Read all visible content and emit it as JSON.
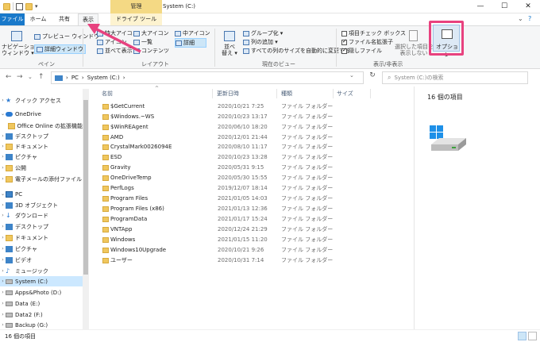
{
  "titlebar": {
    "manage_tab": "管理",
    "window_title": "System (C:)",
    "qat_dropdown": "▾",
    "minimize": "—",
    "maximize": "☐",
    "close": "✕"
  },
  "ribbon_tabs": {
    "file": "ファイル",
    "home": "ホーム",
    "share": "共有",
    "view": "表示",
    "drive_tools": "ドライブ ツール",
    "collapse": "⌄",
    "help": "?"
  },
  "ribbon": {
    "pane_group": {
      "navigation_pane": "ナビゲーション\nウィンドウ ▾",
      "preview_pane": "プレビュー ウィンドウ",
      "details_pane": "詳細ウィンドウ",
      "label": "ペイン"
    },
    "layout_group": {
      "extra_large_icons": "特大アイコン",
      "large_icons": "大アイコン",
      "medium_icons": "中アイコン",
      "small_icons": "アイコン",
      "list": "一覧",
      "details": "詳細",
      "tiles": "並べて表示",
      "content": "コンテンツ",
      "label": "レイアウト"
    },
    "current_view_group": {
      "sort": "並べ\n替え ▾",
      "group_by": "グループ化 ▾",
      "add_columns": "列の追加 ▾",
      "size_all_columns": "すべての列のサイズを自動的に変更する",
      "label": "現在のビュー"
    },
    "show_hide_group": {
      "item_checkboxes": "項目チェック ボックス",
      "file_extensions": "ファイル名拡張子",
      "hidden_items": "隠しファイル",
      "hide_selected": "選択した項目を\n表示しない",
      "label": "表示/非表示"
    },
    "options": "オプション"
  },
  "address_bar": {
    "back": "←",
    "forward": "→",
    "recent": "⌄",
    "up": "↑",
    "path": [
      "PC",
      "System (C:)"
    ],
    "separator": "›",
    "dropdown": "⌄",
    "refresh": "↻",
    "search_placeholder": "System (C:)の検索"
  },
  "nav_pane": {
    "items": [
      {
        "label": "クイック アクセス"
      },
      {
        "label": "OneDrive"
      },
      {
        "label": "Office Online の拡張機能"
      },
      {
        "label": "デスクトップ"
      },
      {
        "label": "ドキュメント"
      },
      {
        "label": "ピクチャ"
      },
      {
        "label": "公開"
      },
      {
        "label": "電子メールの添付ファイル"
      },
      {
        "label": "PC"
      },
      {
        "label": "3D オブジェクト"
      },
      {
        "label": "ダウンロード"
      },
      {
        "label": "デスクトップ"
      },
      {
        "label": "ドキュメント"
      },
      {
        "label": "ピクチャ"
      },
      {
        "label": "ビデオ"
      },
      {
        "label": "ミュージック"
      },
      {
        "label": "System (C:)"
      },
      {
        "label": "Apps&Photo (D:)"
      },
      {
        "label": "Data (E:)"
      },
      {
        "label": "Data2 (F:)"
      },
      {
        "label": "Backup (G:)"
      }
    ]
  },
  "file_list": {
    "columns": {
      "name": "名前",
      "date": "更新日時",
      "type": "種類",
      "size": "サイズ"
    },
    "sort_indicator": "^",
    "rows": [
      {
        "name": "$GetCurrent",
        "date": "2020/10/21 7:25",
        "type": "ファイル フォルダー"
      },
      {
        "name": "$Windows.~WS",
        "date": "2020/10/23 13:17",
        "type": "ファイル フォルダー"
      },
      {
        "name": "$WinREAgent",
        "date": "2020/06/10 18:20",
        "type": "ファイル フォルダー"
      },
      {
        "name": "AMD",
        "date": "2020/12/01 21:44",
        "type": "ファイル フォルダー"
      },
      {
        "name": "CrystalMark0026094E",
        "date": "2020/08/10 11:17",
        "type": "ファイル フォルダー"
      },
      {
        "name": "ESD",
        "date": "2020/10/23 13:28",
        "type": "ファイル フォルダー"
      },
      {
        "name": "Gravity",
        "date": "2020/05/31 9:15",
        "type": "ファイル フォルダー"
      },
      {
        "name": "OneDriveTemp",
        "date": "2020/05/30 15:55",
        "type": "ファイル フォルダー"
      },
      {
        "name": "PerfLogs",
        "date": "2019/12/07 18:14",
        "type": "ファイル フォルダー"
      },
      {
        "name": "Program Files",
        "date": "2021/01/05 14:03",
        "type": "ファイル フォルダー"
      },
      {
        "name": "Program Files (x86)",
        "date": "2021/01/13 12:36",
        "type": "ファイル フォルダー"
      },
      {
        "name": "ProgramData",
        "date": "2021/01/17 15:24",
        "type": "ファイル フォルダー"
      },
      {
        "name": "VNTApp",
        "date": "2020/12/24 21:29",
        "type": "ファイル フォルダー"
      },
      {
        "name": "Windows",
        "date": "2021/01/15 11:20",
        "type": "ファイル フォルダー"
      },
      {
        "name": "Windows10Upgrade",
        "date": "2020/10/21 9:26",
        "type": "ファイル フォルダー"
      },
      {
        "name": "ユーザー",
        "date": "2020/10/31 7:14",
        "type": "ファイル フォルダー"
      }
    ]
  },
  "preview": {
    "title": "16 個の項目"
  },
  "status": {
    "text": "16 個の項目"
  },
  "colors": {
    "accent": "#1979ca",
    "manage_tab": "#f4d984",
    "highlight_box": "#e8427f",
    "selected_bg": "#cce8ff"
  }
}
